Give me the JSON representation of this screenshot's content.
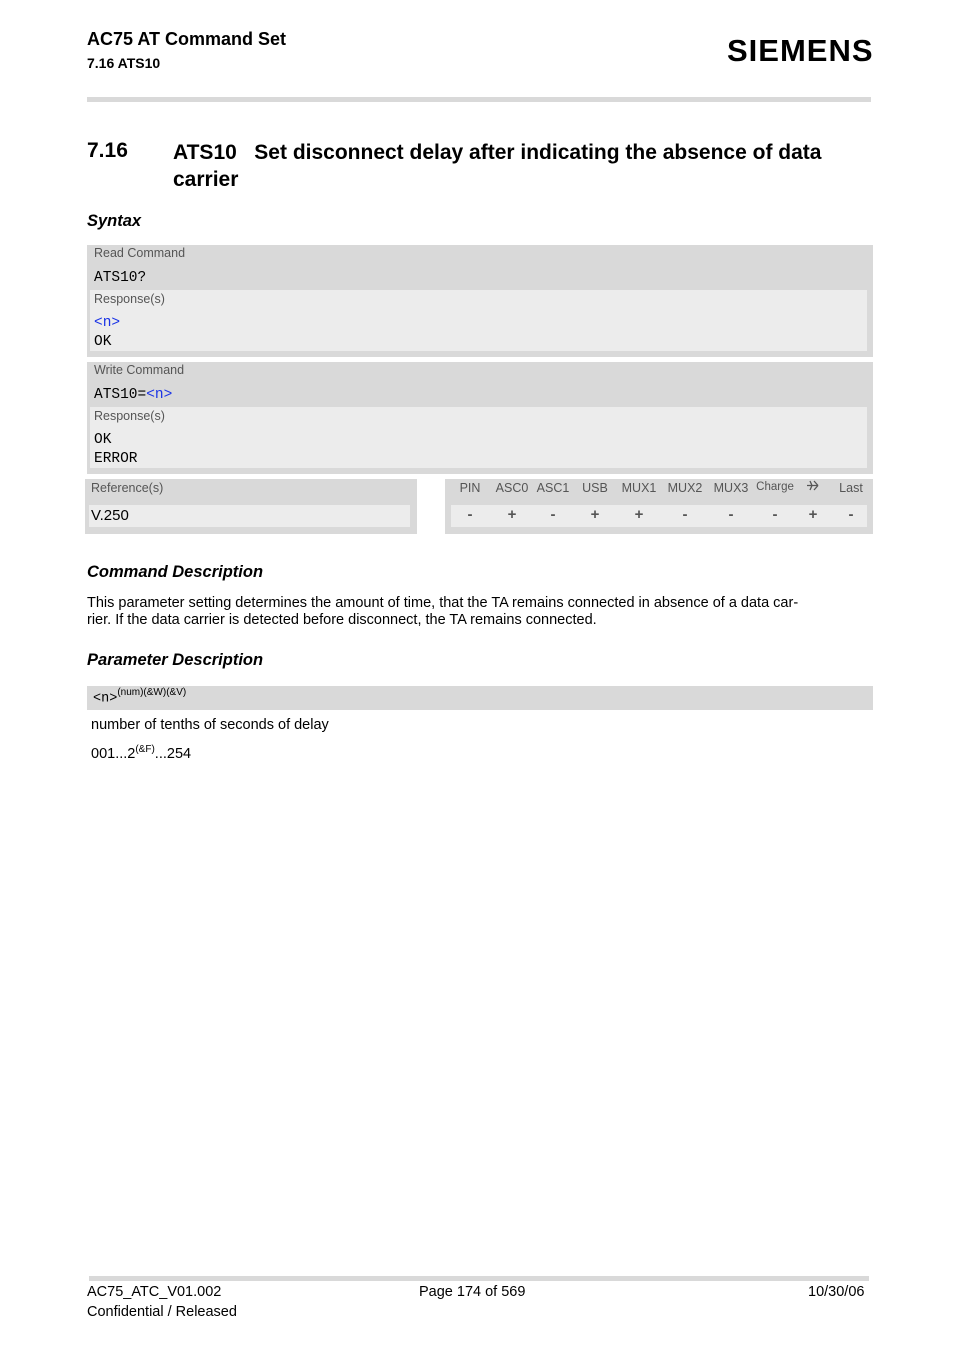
{
  "header": {
    "doc_title": "AC75 AT Command Set",
    "section_ref": "7.16 ATS10",
    "brand_logo": "SIEMENS"
  },
  "section": {
    "number": "7.16",
    "title": "ATS10   Set disconnect delay after indicating the absence of data carrier"
  },
  "syntax": {
    "heading": "Syntax",
    "read_command": {
      "label": "Read Command",
      "command": "ATS10?",
      "response_label": "Response(s)",
      "responses": [
        "<n>",
        "OK"
      ]
    },
    "write_command": {
      "label": "Write Command",
      "command_prefix": "ATS10=",
      "command_param": "<n>",
      "response_label": "Response(s)",
      "responses": [
        "OK",
        "ERROR"
      ]
    },
    "reference": {
      "label": "Reference(s)",
      "value": "V.250"
    },
    "support_table": {
      "columns": [
        {
          "name": "PIN",
          "value": "-"
        },
        {
          "name": "ASC0",
          "value": "+"
        },
        {
          "name": "ASC1",
          "value": "-"
        },
        {
          "name": "USB",
          "value": "+"
        },
        {
          "name": "MUX1",
          "value": "+"
        },
        {
          "name": "MUX2",
          "value": "-"
        },
        {
          "name": "MUX3",
          "value": "-"
        },
        {
          "name": "Charge",
          "value": "-"
        },
        {
          "name": "airplane-icon",
          "value": "+"
        },
        {
          "name": "Last",
          "value": "-"
        }
      ]
    }
  },
  "command_description": {
    "heading": "Command Description",
    "line1": "This parameter setting determines the amount of time, that the TA remains connected in absence of a data car-",
    "line2": "rier. If the data carrier is detected before disconnect, the TA remains connected."
  },
  "parameter_description": {
    "heading": "Parameter Description",
    "param_name": "<n>",
    "param_attrs": "(num)(&W)(&V)",
    "description": "number of tenths of seconds of delay",
    "range_start": "001...2",
    "range_default_marker": "(&F)",
    "range_end": "...254"
  },
  "footer": {
    "doc_id": "AC75_ATC_V01.002",
    "status": "Confidential / Released",
    "page": "Page 174 of 569",
    "date": "10/30/06"
  }
}
